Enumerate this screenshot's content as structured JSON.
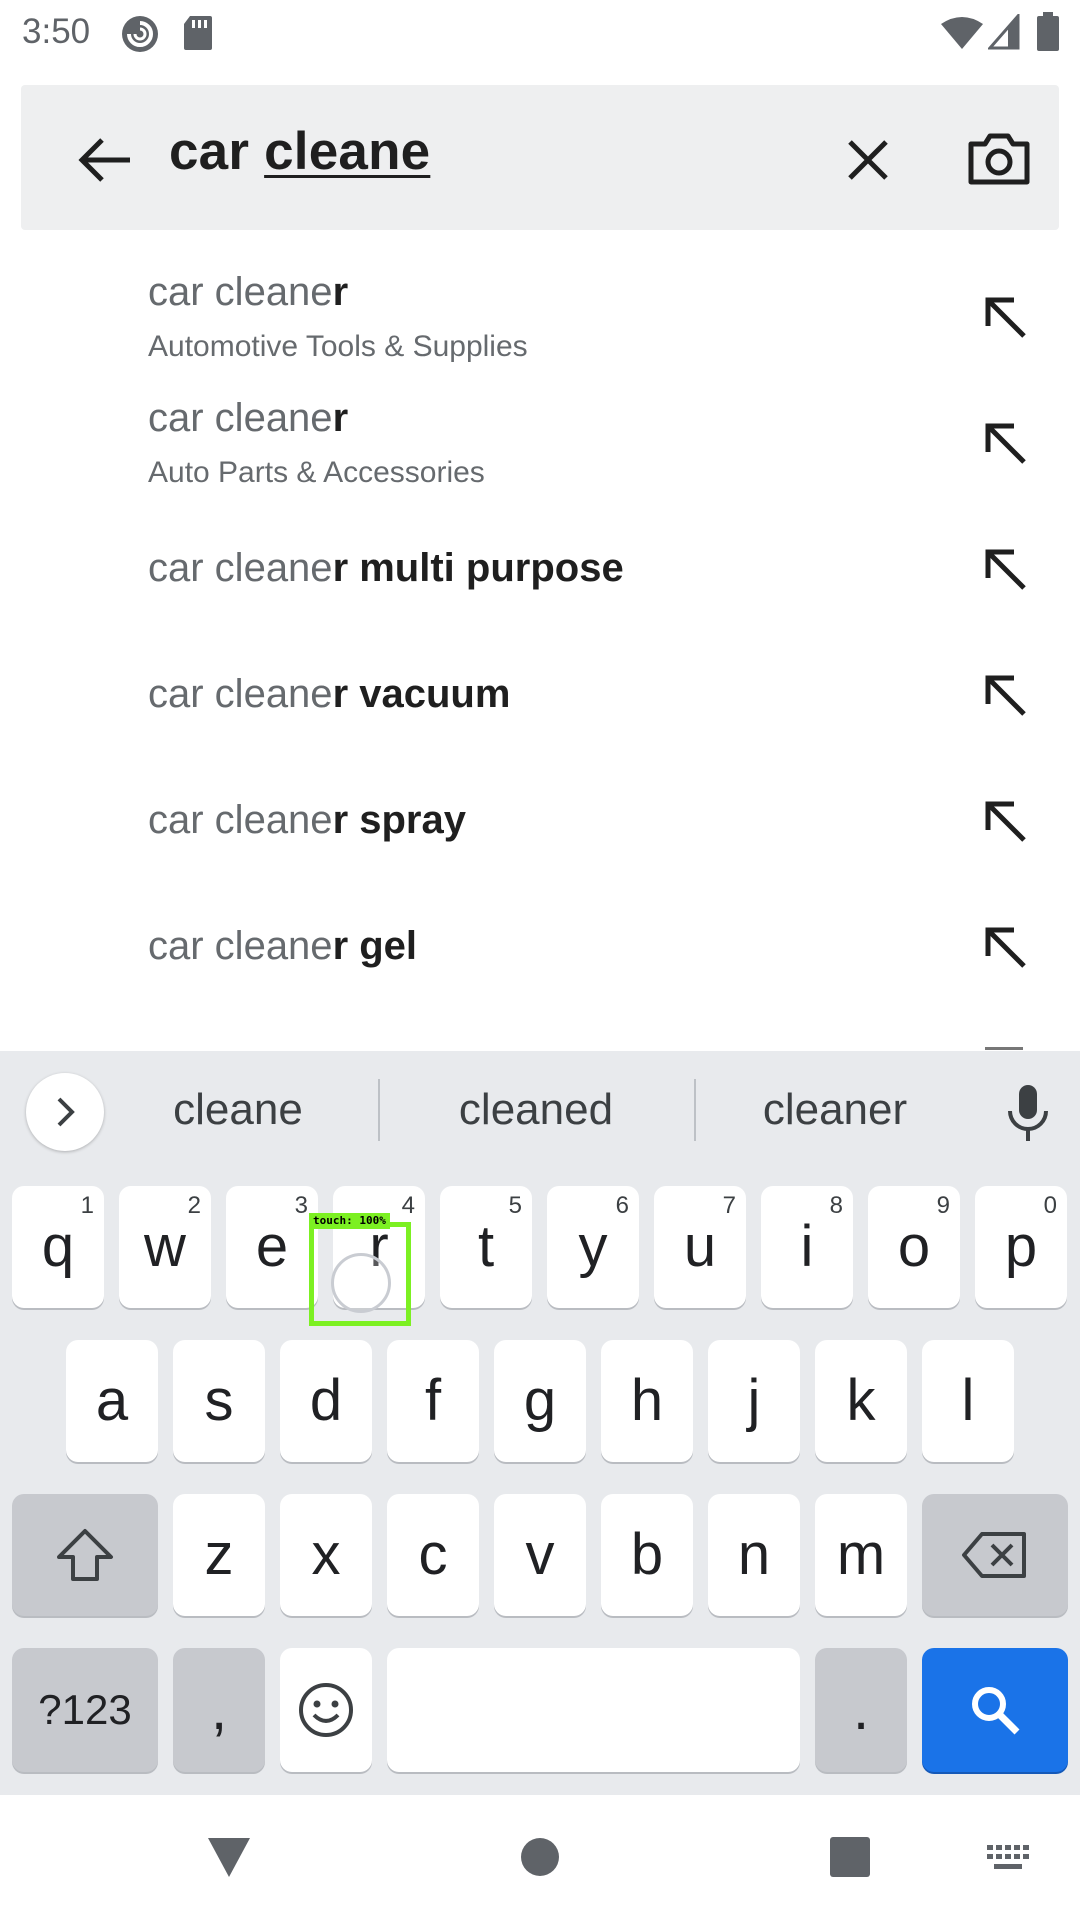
{
  "status_bar": {
    "time": "3:50",
    "icons": [
      "pocket-casts-icon",
      "sd-card-icon",
      "wifi-icon",
      "cell-signal-icon",
      "battery-icon"
    ]
  },
  "search": {
    "prefix": "car ",
    "composing": "cleane",
    "icons": [
      "back-arrow-icon",
      "clear-icon",
      "camera-icon"
    ]
  },
  "suggestions": [
    {
      "typed": "car cleane",
      "completion": "r",
      "category": "Automotive Tools & Supplies"
    },
    {
      "typed": "car cleane",
      "completion": "r",
      "category": "Auto Parts & Accessories"
    },
    {
      "typed": "car cleane",
      "completion": "r multi purpose",
      "category": ""
    },
    {
      "typed": "car cleane",
      "completion": "r vacuum",
      "category": ""
    },
    {
      "typed": "car cleane",
      "completion": "r spray",
      "category": ""
    },
    {
      "typed": "car cleane",
      "completion": "r gel",
      "category": ""
    }
  ],
  "keyboard": {
    "strip": [
      "cleane",
      "cleaned",
      "cleaner"
    ],
    "row1": [
      {
        "k": "q",
        "h": "1"
      },
      {
        "k": "w",
        "h": "2"
      },
      {
        "k": "e",
        "h": "3"
      },
      {
        "k": "r",
        "h": "4"
      },
      {
        "k": "t",
        "h": "5"
      },
      {
        "k": "y",
        "h": "6"
      },
      {
        "k": "u",
        "h": "7"
      },
      {
        "k": "i",
        "h": "8"
      },
      {
        "k": "o",
        "h": "9"
      },
      {
        "k": "p",
        "h": "0"
      }
    ],
    "row2": [
      "a",
      "s",
      "d",
      "f",
      "g",
      "h",
      "j",
      "k",
      "l"
    ],
    "row3": [
      "z",
      "x",
      "c",
      "v",
      "b",
      "n",
      "m"
    ],
    "symbols_label": "?123",
    "comma_label": ",",
    "period_label": ".",
    "accent_color": "#1a73e8"
  },
  "touch_indicator": "touch: 100%"
}
